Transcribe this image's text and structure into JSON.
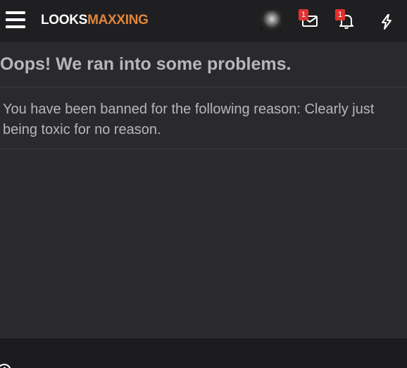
{
  "header": {
    "logo_part1": "LOOKS",
    "logo_part2": "MAXXING",
    "brand_color": "#e0863a",
    "inbox_badge": "1",
    "alerts_badge": "1",
    "icons": [
      "menu-icon",
      "avatar",
      "envelope-icon",
      "bell-icon",
      "lightning-icon"
    ]
  },
  "main": {
    "title": "Oops! We ran into some problems.",
    "message": "You have been banned for the following reason: Clearly just being toxic for no reason."
  }
}
